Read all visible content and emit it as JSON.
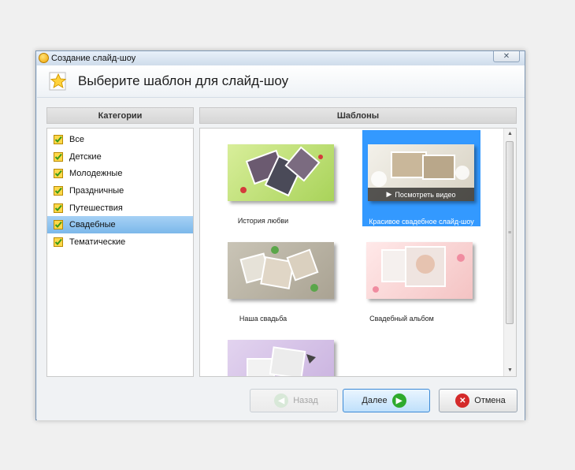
{
  "window": {
    "title": "Создание слайд-шоу",
    "close": "✕"
  },
  "header": {
    "text": "Выберите шаблон для слайд-шоу"
  },
  "categories": {
    "header": "Категории",
    "items": [
      {
        "label": "Все"
      },
      {
        "label": "Детские"
      },
      {
        "label": "Молодежные"
      },
      {
        "label": "Праздничные"
      },
      {
        "label": "Путешествия"
      },
      {
        "label": "Свадебные"
      },
      {
        "label": "Тематические"
      }
    ],
    "selected": "Свадебные"
  },
  "templates": {
    "header": "Шаблоны",
    "items": [
      {
        "label": "История любви"
      },
      {
        "label": "Красивое свадебное слайд-шоу",
        "play_label": "Посмотреть видео"
      },
      {
        "label": "Наша свадьба"
      },
      {
        "label": "Свадебный альбом"
      },
      {
        "label": ""
      }
    ],
    "selected": "Красивое свадебное слайд-шоу"
  },
  "buttons": {
    "back": "Назад",
    "next": "Далее",
    "cancel": "Отмена"
  },
  "colors": {
    "selection": "#3399ff",
    "accent_green": "#2eaa2e",
    "cancel_red": "#d42a2a"
  }
}
